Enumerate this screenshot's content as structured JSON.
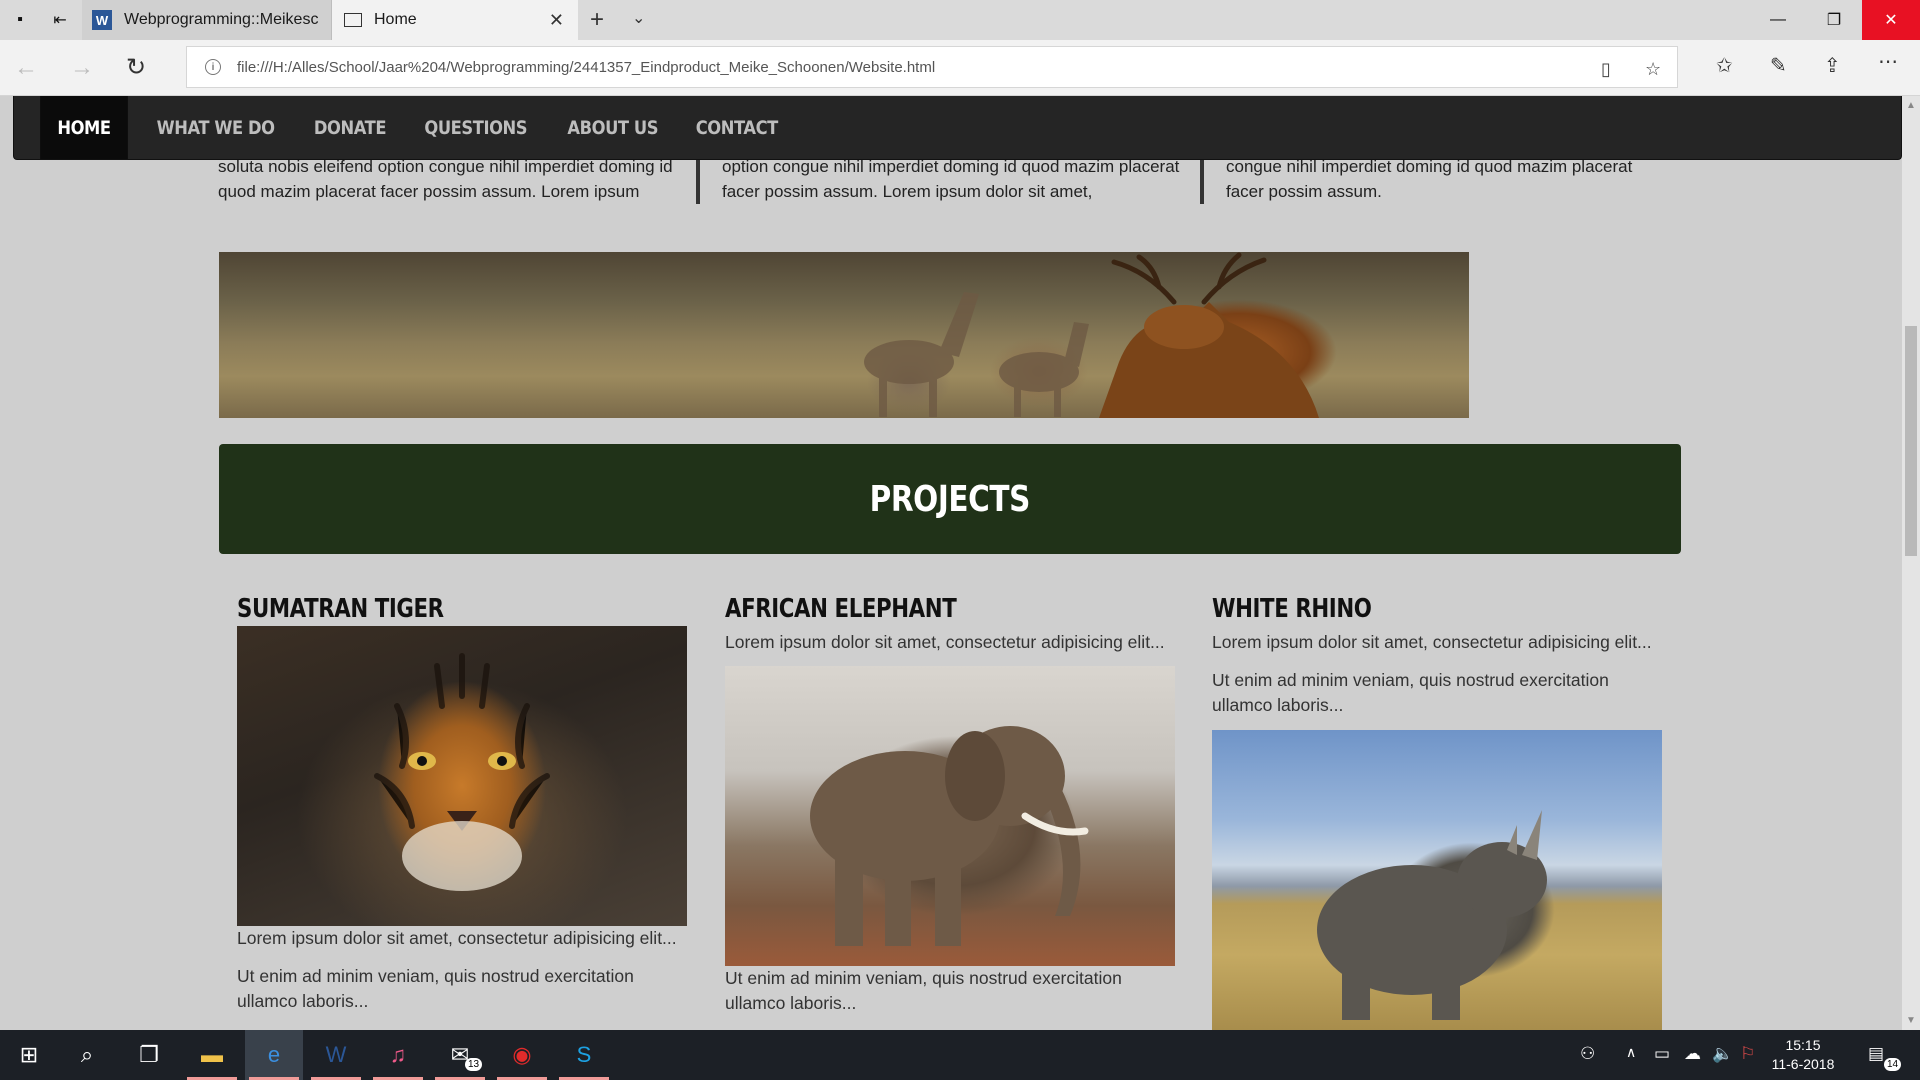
{
  "window": {
    "tabs": [
      {
        "label": "Webprogramming::Meikesc",
        "icon": "word-icon"
      },
      {
        "label": "Home",
        "icon": "page-icon"
      }
    ],
    "controls": [
      "minimize",
      "restore",
      "close"
    ]
  },
  "addressbar": {
    "url": "file:///H:/Alles/School/Jaar%204/Webprogramming/2441357_Eindproduct_Meike_Schoonen/Website.html"
  },
  "site": {
    "nav": [
      "HOME",
      "WHAT WE DO",
      "DONATE",
      "QUESTIONS",
      "ABOUT US",
      "CONTACT"
    ],
    "active_nav": "HOME",
    "text_columns": [
      "soluta nobis eleifend option congue nihil imperdiet doming id quod mazim placerat facer possim assum. Lorem ipsum",
      "option congue nihil imperdiet doming id quod mazim placerat facer possim assum. Lorem ipsum dolor sit amet,",
      "congue nihil imperdiet doming id quod mazim placerat facer possim assum."
    ],
    "projects_heading": "PROJECTS",
    "projects": [
      {
        "title": "SUMATRAN TIGER",
        "p1": "Lorem ipsum dolor sit amet, consectetur adipisicing elit...",
        "p2": "Ut enim ad minim veniam, quis nostrud exercitation ullamco laboris..."
      },
      {
        "title": "AFRICAN ELEPHANT",
        "p1": "Lorem ipsum dolor sit amet, consectetur adipisicing elit...",
        "p2": "Ut enim ad minim veniam, quis nostrud exercitation ullamco laboris..."
      },
      {
        "title": "WHITE RHINO",
        "p1": "Lorem ipsum dolor sit amet, consectetur adipisicing elit...",
        "p2": "Ut enim ad minim veniam, quis nostrud exercitation ullamco laboris..."
      }
    ],
    "colors": {
      "nav_bg": "#252525",
      "projects_bar": "#203218",
      "page_bg": "#cfcfcf"
    }
  },
  "taskbar": {
    "apps": [
      "start",
      "search",
      "task-view",
      "file-explorer",
      "edge",
      "word",
      "itunes",
      "mail",
      "creative-cloud",
      "skype"
    ],
    "mail_badge": "13",
    "time": "15:15",
    "date": "11-6-2018",
    "notification_count": "14"
  }
}
